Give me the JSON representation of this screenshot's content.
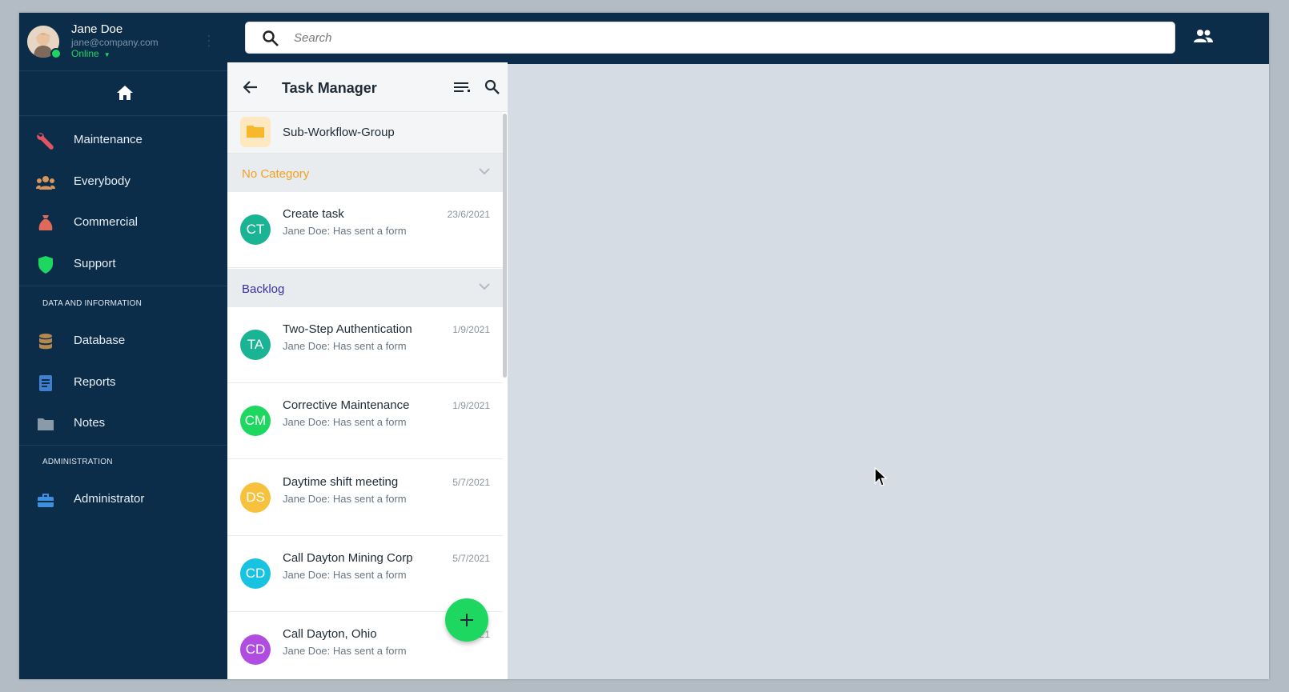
{
  "user": {
    "name": "Jane Doe",
    "email": "jane@company.com",
    "status": "Online"
  },
  "sidebar": {
    "main_items": [
      {
        "label": "Maintenance",
        "icon": "wrench-icon",
        "color": "#e0555f"
      },
      {
        "label": "Everybody",
        "icon": "people-icon",
        "color": "#d9955b"
      },
      {
        "label": "Commercial",
        "icon": "money-bag-icon",
        "color": "#e06a5a"
      },
      {
        "label": "Support",
        "icon": "shield-icon",
        "color": "#1ed760"
      }
    ],
    "data_section_title": "DATA AND INFORMATION",
    "data_items": [
      {
        "label": "Database",
        "icon": "database-icon",
        "color": "#b5894d"
      },
      {
        "label": "Reports",
        "icon": "document-icon",
        "color": "#3f7fd0"
      },
      {
        "label": "Notes",
        "icon": "folder-icon",
        "color": "#8a9aa8"
      }
    ],
    "admin_section_title": "ADMINISTRATION",
    "admin_items": [
      {
        "label": "Administrator",
        "icon": "toolbox-icon",
        "color": "#3f8fe0"
      }
    ]
  },
  "search": {
    "placeholder": "Search"
  },
  "panel": {
    "title": "Task Manager",
    "group": {
      "label": "Sub-Workflow-Group",
      "icon": "folder-icon"
    },
    "categories": [
      {
        "label": "No Category",
        "color": "#f0a023",
        "tasks": [
          {
            "initials": "CT",
            "title": "Create task",
            "subtitle": "Jane Doe: Has sent a form",
            "date": "23/6/2021",
            "color": "#1ab394"
          }
        ]
      },
      {
        "label": "Backlog",
        "color": "#3b2ea0",
        "tasks": [
          {
            "initials": "TA",
            "title": "Two-Step Authentication",
            "subtitle": "Jane Doe: Has sent a form",
            "date": "1/9/2021",
            "color": "#1ab394"
          },
          {
            "initials": "CM",
            "title": "Corrective Maintenance",
            "subtitle": "Jane Doe: Has sent a form",
            "date": "1/9/2021",
            "color": "#1ed760"
          },
          {
            "initials": "DS",
            "title": "Daytime shift meeting",
            "subtitle": "Jane Doe: Has sent a form",
            "date": "5/7/2021",
            "color": "#f6c23e"
          },
          {
            "initials": "CD",
            "title": "Call Dayton Mining Corp",
            "subtitle": "Jane Doe: Has sent a form",
            "date": "5/7/2021",
            "color": "#17c3e0"
          },
          {
            "initials": "CD",
            "title": "Call Dayton, Ohio",
            "subtitle": "Jane Doe: Has sent a form",
            "date": "5/7/2021",
            "color": "#b04de0"
          }
        ]
      }
    ]
  },
  "fab": {
    "icon": "plus-icon"
  }
}
